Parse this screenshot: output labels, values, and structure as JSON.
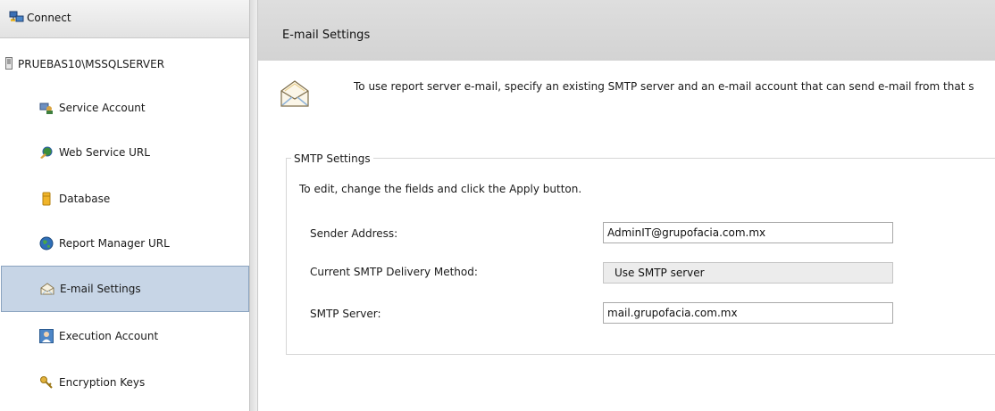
{
  "sidebar": {
    "connect_label": "Connect",
    "server_name": "PRUEBAS10\\MSSQLSERVER",
    "items": [
      {
        "label": "Service Account",
        "icon": "service-account-icon"
      },
      {
        "label": "Web Service URL",
        "icon": "web-service-icon"
      },
      {
        "label": "Database",
        "icon": "database-icon"
      },
      {
        "label": "Report Manager URL",
        "icon": "globe-icon"
      },
      {
        "label": "E-mail Settings",
        "icon": "envelope-icon",
        "selected": true
      },
      {
        "label": "Execution Account",
        "icon": "user-account-icon"
      },
      {
        "label": "Encryption Keys",
        "icon": "key-icon"
      }
    ]
  },
  "main": {
    "title": "E-mail Settings",
    "intro": "To use report server e-mail, specify an existing SMTP server and an e-mail account that can send e-mail from that s",
    "smtp": {
      "legend": "SMTP Settings",
      "instructions": "To edit, change the fields and click the Apply button.",
      "sender_label": "Sender Address:",
      "sender_value": "AdminIT@grupofacia.com.mx",
      "method_label": "Current SMTP Delivery Method:",
      "method_value": "Use SMTP server",
      "server_label": "SMTP Server:",
      "server_value": "mail.grupofacia.com.mx"
    }
  },
  "colors": {
    "selected_bg": "#c7d5e6",
    "header_bg": "#d8d8d8"
  }
}
